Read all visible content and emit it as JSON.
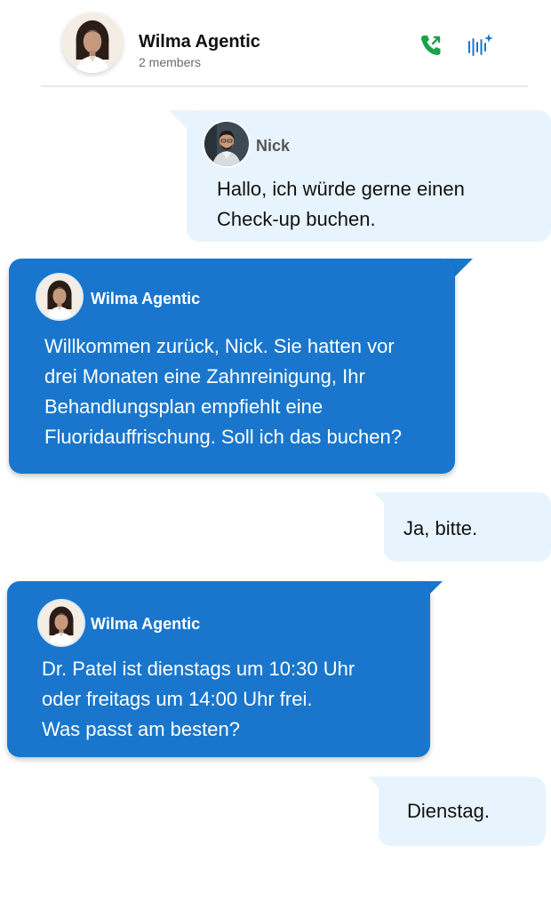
{
  "header": {
    "title": "Wilma Agentic",
    "subtitle": "2 members",
    "avatar_icon": "woman-avatar-icon",
    "actions": [
      {
        "name": "phone-call-icon",
        "color": "#1aa34a"
      },
      {
        "name": "voice-wave-sparkle-icon",
        "color": "#1976cc"
      }
    ]
  },
  "colors": {
    "agent_bubble": "#1976cc",
    "user_bubble": "#e8f4fd",
    "call_green": "#1aa34a"
  },
  "messages": [
    {
      "sender": "Nick",
      "role": "user",
      "text_lines": [
        "Hallo, ich würde gerne einen",
        "Check-up buchen."
      ]
    },
    {
      "sender": "Wilma Agentic",
      "role": "agent",
      "text_lines": [
        "Willkommen zurück, Nick. Sie hatten vor",
        "drei Monaten eine Zahnreinigung, Ihr",
        "Behandlungsplan empfiehlt eine",
        "Fluoridauffrischung. Soll ich das buchen?"
      ]
    },
    {
      "role": "user",
      "text_lines": [
        "Ja, bitte."
      ]
    },
    {
      "sender": "Wilma Agentic",
      "role": "agent",
      "text_lines": [
        "Dr. Patel ist dienstags um 10:30 Uhr",
        "oder freitags um 14:00 Uhr frei.",
        "Was passt am besten?"
      ]
    },
    {
      "role": "user",
      "text_lines": [
        "Dienstag."
      ]
    }
  ]
}
